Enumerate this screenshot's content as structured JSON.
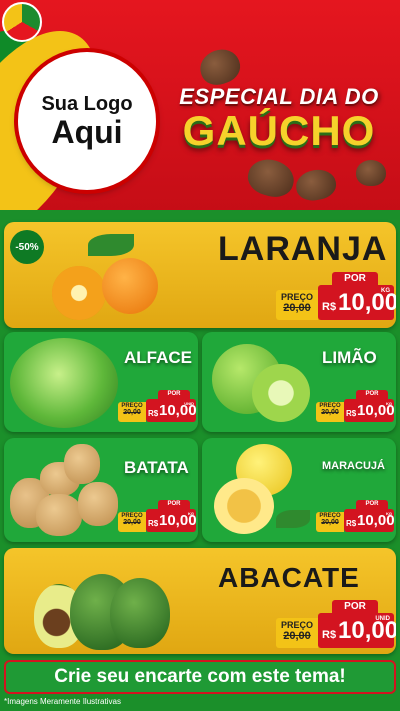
{
  "header": {
    "logo_line1": "Sua Logo",
    "logo_line2": "Aqui",
    "title_line1": "ESPECIAL DIA DO",
    "title_line2": "GAÚCHO"
  },
  "products": [
    {
      "name": "LARANJA",
      "badge": "-50%",
      "old_label": "PREÇO",
      "old_price": "20,00",
      "por": "POR",
      "currency": "R$",
      "price": "10,00",
      "unit": "KG"
    },
    {
      "name": "ALFACE",
      "old_label": "PREÇO",
      "old_price": "20,00",
      "por": "POR",
      "currency": "R$",
      "price": "10,00",
      "unit": "UNID"
    },
    {
      "name": "LIMÃO",
      "old_label": "PREÇO",
      "old_price": "20,00",
      "por": "POR",
      "currency": "R$",
      "price": "10,00",
      "unit": "KG"
    },
    {
      "name": "BATATA",
      "old_label": "PREÇO",
      "old_price": "20,00",
      "por": "POR",
      "currency": "R$",
      "price": "10,00",
      "unit": "KG"
    },
    {
      "name": "MARACUJÁ",
      "old_label": "PREÇO",
      "old_price": "20,00",
      "por": "POR",
      "currency": "R$",
      "price": "10,00",
      "unit": "KG"
    },
    {
      "name": "ABACATE",
      "old_label": "PREÇO",
      "old_price": "20,00",
      "por": "POR",
      "currency": "R$",
      "price": "10,00",
      "unit": "UNID"
    }
  ],
  "footer": {
    "cta": "Crie seu encarte com este tema!",
    "disclaimer": "*Imagens Meramente Ilustrativas"
  },
  "colors": {
    "red": "#d31420",
    "green": "#1b8f2a",
    "yellow": "#f3c317"
  },
  "icons": [
    "rio-grande-do-sul-flag-icon",
    "cuia-chimarrao-icon"
  ]
}
